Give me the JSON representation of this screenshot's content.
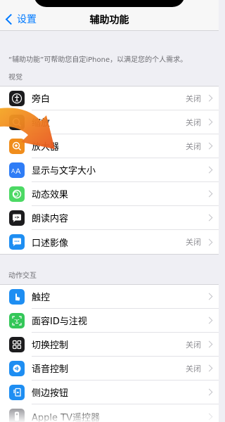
{
  "nav": {
    "back_label": "设置",
    "title": "辅助功能"
  },
  "description": "“辅助功能”可帮助您自定iPhone，以满足您的个人需求。",
  "sections": [
    {
      "header": "视觉",
      "rows": [
        {
          "label": "旁白",
          "value": "关闭",
          "icon": "voiceover-icon",
          "color": "#1c1c1e"
        },
        {
          "label": "缩放",
          "value": "关闭",
          "icon": "zoom-icon",
          "color": "#1c1c1e"
        },
        {
          "label": "放大器",
          "value": "关闭",
          "icon": "magnifier-icon",
          "color": "#f08d1c"
        },
        {
          "label": "显示与文字大小",
          "value": "",
          "icon": "text-size-icon",
          "color": "#2f7df6"
        },
        {
          "label": "动态效果",
          "value": "",
          "icon": "motion-icon",
          "color": "#4cd964"
        },
        {
          "label": "朗读内容",
          "value": "",
          "icon": "spoken-content-icon",
          "color": "#1c1c1e"
        },
        {
          "label": "口述影像",
          "value": "关闭",
          "icon": "audio-descriptions-icon",
          "color": "#1e8ef2"
        }
      ]
    },
    {
      "header": "动作交互",
      "rows": [
        {
          "label": "触控",
          "value": "",
          "icon": "touch-icon",
          "color": "#1e8ef2"
        },
        {
          "label": "面容ID与注视",
          "value": "",
          "icon": "face-id-icon",
          "color": "#34c759"
        },
        {
          "label": "切换控制",
          "value": "关闭",
          "icon": "switch-control-icon",
          "color": "#1c1c1e"
        },
        {
          "label": "语音控制",
          "value": "关闭",
          "icon": "voice-control-icon",
          "color": "#1e8ef2"
        },
        {
          "label": "侧边按钮",
          "value": "",
          "icon": "side-button-icon",
          "color": "#1e8ef2"
        },
        {
          "label": "Apple TV遥控器",
          "value": "",
          "icon": "apple-tv-remote-icon",
          "color": "#8e8e93"
        }
      ]
    }
  ]
}
